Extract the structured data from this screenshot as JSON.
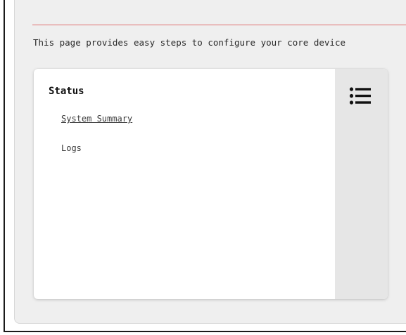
{
  "intro": {
    "text": "This page provides easy steps to configure your core device"
  },
  "status_card": {
    "title": "Status",
    "links": [
      {
        "label": "System Summary"
      },
      {
        "label": "Logs"
      }
    ],
    "menu_icon": "list-menu-icon"
  },
  "colors": {
    "panel_background": "#efefef",
    "card_background": "#ffffff",
    "side_strip": "#e6e6e6",
    "divider_accent": "#e07070"
  }
}
